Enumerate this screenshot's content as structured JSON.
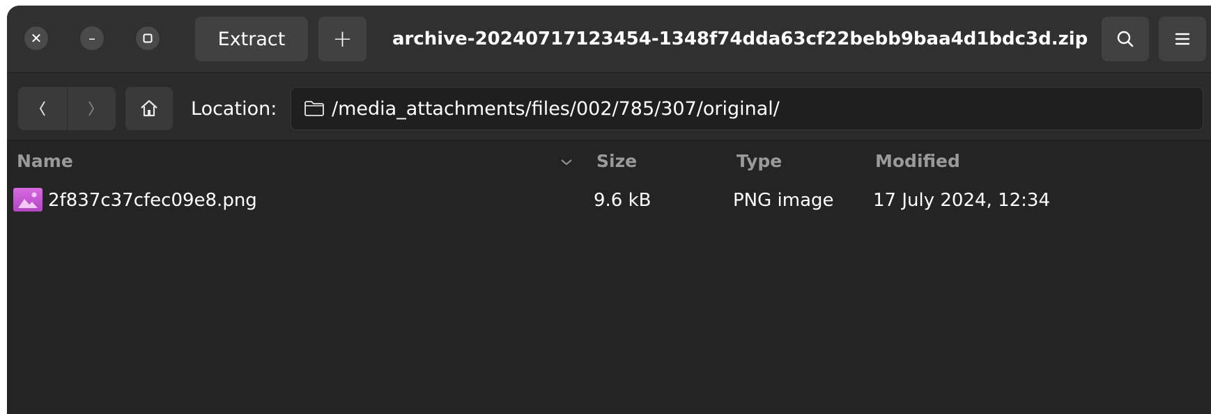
{
  "window": {
    "title": "archive-20240717123454-1348f74dda63cf22bebb9baa4d1bdc3d.zip"
  },
  "headerbar": {
    "close_icon": "✕",
    "minimize_icon": "–",
    "maximize_icon": "☐",
    "extract_label": "Extract",
    "add_label": "+"
  },
  "toolbar": {
    "location_label": "Location:",
    "location_path": "/media_attachments/files/002/785/307/original/"
  },
  "list": {
    "columns": [
      "Name",
      "Size",
      "Type",
      "Modified"
    ],
    "rows": [
      {
        "name": "2f837c37cfec09e8.png",
        "size": "9.6 kB",
        "type": "PNG image",
        "modified": "17 July 2024, 12:34",
        "icon": "image-file-icon"
      }
    ]
  },
  "colors": {
    "window_bg": "#242424",
    "headerbar_bg": "#303030",
    "button_bg": "#414141",
    "header_text": "#9a9a9a",
    "image_icon": "#c95ad6"
  }
}
